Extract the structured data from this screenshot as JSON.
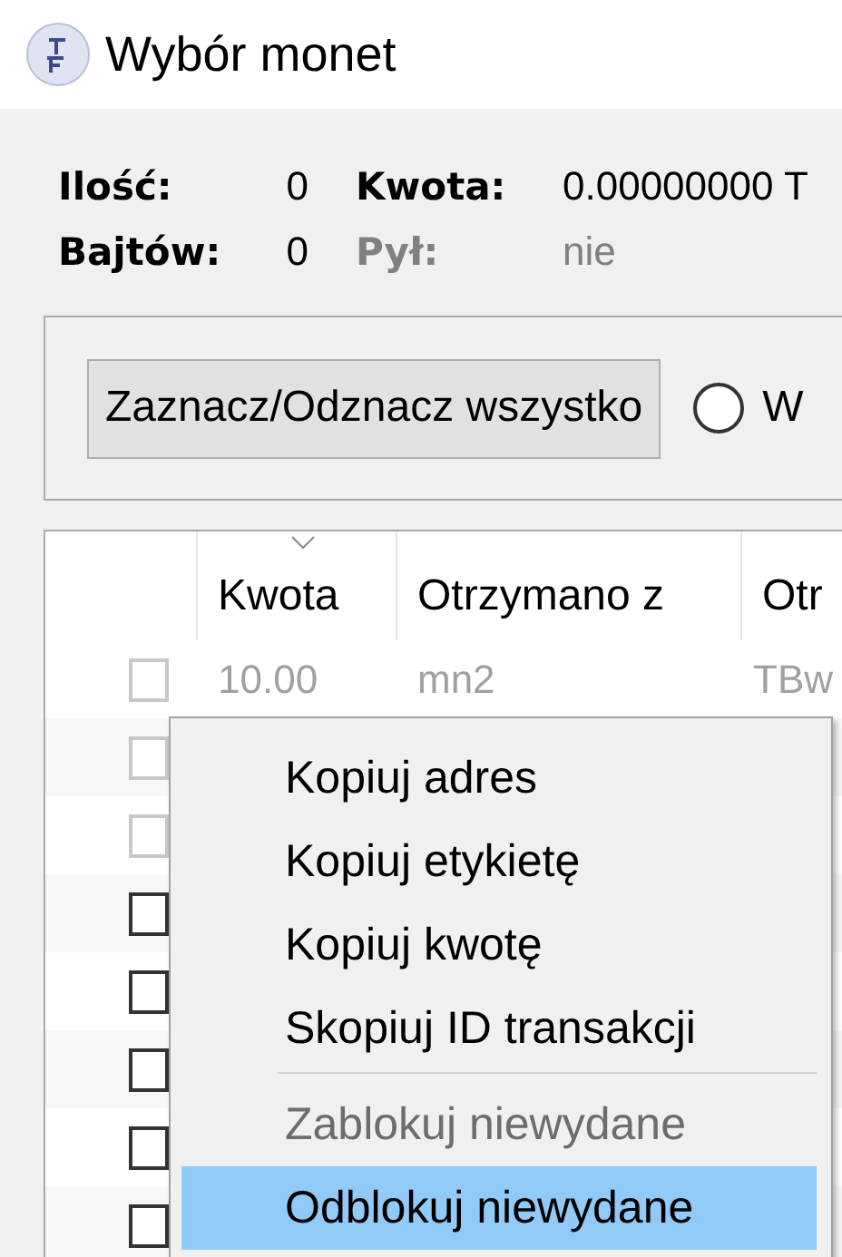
{
  "window": {
    "title": "Wybór monet"
  },
  "summary": [
    [
      {
        "label": "Ilość:",
        "value": "0",
        "disabled": false
      },
      {
        "label": "Kwota:",
        "value": "0.00000000 T",
        "disabled": false
      }
    ],
    [
      {
        "label": "Bajtów:",
        "value": "0",
        "disabled": false
      },
      {
        "label": "Pył:",
        "value": "nie",
        "disabled": true
      }
    ]
  ],
  "toolbar": {
    "button": "Zaznacz/Odznacz wszystko",
    "radio": {
      "label": "W",
      "selected": false
    }
  },
  "table": {
    "columns": [
      {
        "label": "Kwota",
        "sorted": true
      },
      {
        "label": "Otrzymano z",
        "sorted": false
      },
      {
        "label": "Otr",
        "sorted": false
      }
    ],
    "rows": [
      {
        "checked": false,
        "disabled": true,
        "cells": [
          "10.00",
          "mn2",
          "TBw"
        ]
      },
      {
        "checked": false,
        "disabled": true
      },
      {
        "checked": false,
        "disabled": true
      },
      {
        "checked": false,
        "disabled": false
      },
      {
        "checked": false,
        "disabled": false
      },
      {
        "checked": false,
        "disabled": false
      },
      {
        "checked": false,
        "disabled": false
      },
      {
        "checked": false,
        "disabled": false
      }
    ]
  },
  "context_menu": {
    "items": [
      {
        "kind": "item",
        "label": "Kopiuj adres",
        "disabled": false,
        "selected": false
      },
      {
        "kind": "item",
        "label": "Kopiuj etykietę",
        "disabled": false,
        "selected": false
      },
      {
        "kind": "item",
        "label": "Kopiuj kwotę",
        "disabled": false,
        "selected": false
      },
      {
        "kind": "item",
        "label": "Skopiuj ID transakcji",
        "disabled": false,
        "selected": false
      },
      {
        "kind": "separator"
      },
      {
        "kind": "item",
        "label": "Zablokuj niewydane",
        "disabled": true,
        "selected": false
      },
      {
        "kind": "item",
        "label": "Odblokuj niewydane",
        "disabled": false,
        "selected": true
      }
    ]
  }
}
